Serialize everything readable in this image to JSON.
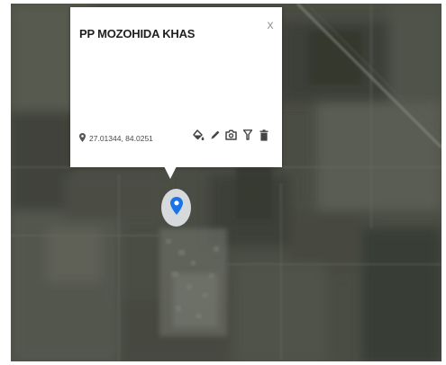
{
  "popup": {
    "title": "PP MOZOHIDA KHAS",
    "close_glyph": "x",
    "coordinates": "27.01344, 84.0251"
  },
  "icons": {
    "location": "map-pin-icon",
    "fill": "paint-bucket-icon",
    "edit": "pencil-icon",
    "photo": "camera-icon",
    "filter": "filter-icon",
    "delete": "trash-icon",
    "marker": "location-marker-icon"
  },
  "colors": {
    "marker": "#1a73e8",
    "popup_bg": "#ffffff",
    "tool_icon": "#444444",
    "imagery_base": "#4a4d44"
  }
}
